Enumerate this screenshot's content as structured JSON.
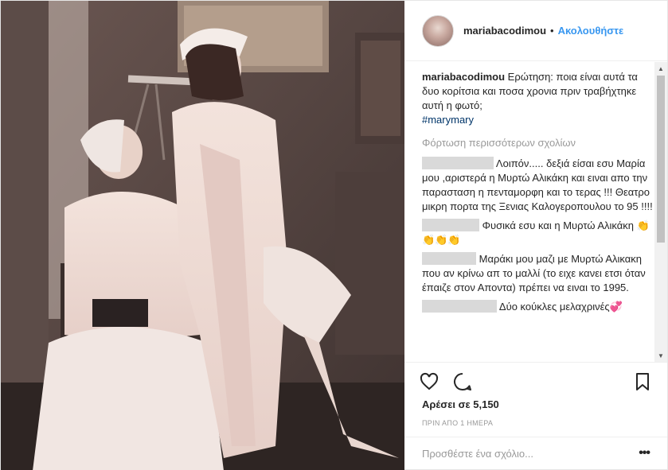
{
  "header": {
    "username": "mariabacodimou",
    "separator": "•",
    "follow_label": "Ακολουθήστε"
  },
  "caption": {
    "username": "mariabacodimou",
    "text": "Ερώτηση: ποια είναι αυτά τα δυο κορίτσια και ποσα χρονια πριν τραβήχτηκε αυτή η φωτό;",
    "hashtag": "#marymary"
  },
  "load_more_label": "Φόρτωση περισσότερων σχολίων",
  "comments": [
    {
      "text": "Λοιπόν..... δεξιά είσαι εσυ Μαρία μου ,αριστερά η Μυρτώ Αλικάκη και ειναι απο την παρασταση η πενταμορφη και το τερας !!! Θεατρο μικρη πορτα της Ξενιας Καλογεροπουλου το 95 !!!!"
    },
    {
      "text": "Φυσικά εσυ και η Μυρτώ Αλικάκη 👏👏👏👏"
    },
    {
      "text": "Μαράκι μου μαζι με Μυρτώ Αλικακη που αν κρίνω απ το μαλλί (το ειχε κανει ετσι όταν έπαιζε στον Αποντα) πρέπει να ειναι το 1995."
    },
    {
      "text": "Δύο κούκλες μελαχρινές💞"
    }
  ],
  "likes_label": "Αρέσει σε 5,150",
  "timestamp": "ΠΡΙΝ ΑΠΟ 1 ΗΜΕΡΑ",
  "add_comment_placeholder": "Προσθέστε ένα σχόλιο...",
  "menu_label": "•••",
  "icons": {
    "like": "heart-icon",
    "comment": "comment-icon",
    "save": "bookmark-icon"
  },
  "colors": {
    "link": "#3897f0",
    "hashtag": "#003569",
    "muted": "#999999",
    "text": "#262626"
  }
}
